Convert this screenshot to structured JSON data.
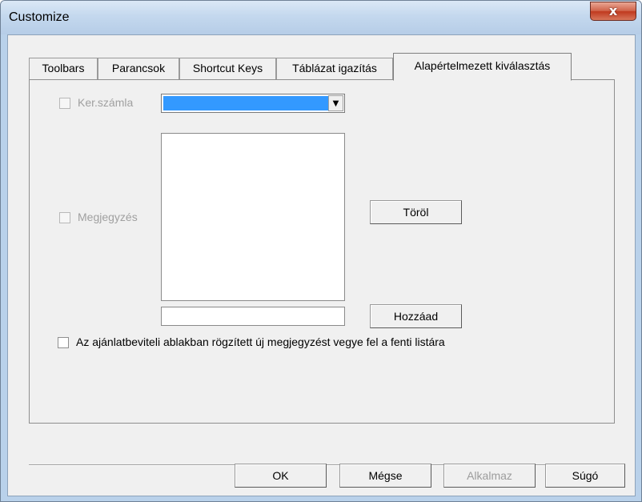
{
  "window": {
    "title": "Customize",
    "close_label": "x"
  },
  "tabs": [
    {
      "label": "Toolbars",
      "active": false
    },
    {
      "label": "Parancsok",
      "active": false
    },
    {
      "label": "Shortcut Keys",
      "active": false
    },
    {
      "label": "Táblázat igazítás",
      "active": false
    },
    {
      "label": "Alapértelmezett kiválasztás",
      "active": true
    }
  ],
  "panel": {
    "kerszamla": {
      "label": "Ker.számla",
      "checked": false,
      "enabled": false
    },
    "combo": {
      "value": "",
      "arrow": "▼"
    },
    "megjegyzes": {
      "label": "Megjegyzés",
      "checked": false,
      "enabled": false
    },
    "torol_label": "Töröl",
    "new_note_value": "",
    "hozzaad_label": "Hozzáad",
    "auto_add": {
      "label": "Az ajánlatbeviteli ablakban rögzített új megjegyzést vegye fel a fenti listára",
      "checked": false
    }
  },
  "footer": {
    "ok_label": "OK",
    "cancel_label": "Mégse",
    "apply_label": "Alkalmaz",
    "help_label": "Súgó"
  },
  "colors": {
    "accent": "#3399ff",
    "title_gradient_top": "#dbe8f6",
    "close_button": "#c0391e"
  }
}
